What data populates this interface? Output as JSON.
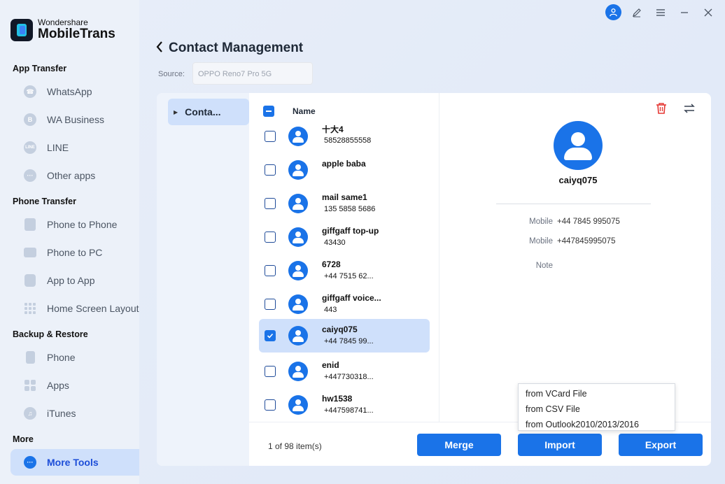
{
  "brand": {
    "line1": "Wondershare",
    "line2": "MobileTrans"
  },
  "sidebar": {
    "sections": [
      {
        "title": "App Transfer",
        "items": [
          {
            "label": "WhatsApp",
            "icon": "whatsapp-icon"
          },
          {
            "label": "WA Business",
            "icon": "wa-business-icon"
          },
          {
            "label": "LINE",
            "icon": "line-icon"
          },
          {
            "label": "Other apps",
            "icon": "other-apps-icon"
          }
        ]
      },
      {
        "title": "Phone Transfer",
        "items": [
          {
            "label": "Phone to Phone",
            "icon": "phone-to-phone-icon"
          },
          {
            "label": "Phone to PC",
            "icon": "phone-to-pc-icon"
          },
          {
            "label": "App to App",
            "icon": "app-to-app-icon"
          },
          {
            "label": "Home Screen Layout",
            "icon": "home-screen-layout-icon"
          }
        ]
      },
      {
        "title": "Backup & Restore",
        "items": [
          {
            "label": "Phone",
            "icon": "phone-backup-icon"
          },
          {
            "label": "Apps",
            "icon": "apps-backup-icon"
          },
          {
            "label": "iTunes",
            "icon": "itunes-icon"
          }
        ]
      },
      {
        "title": "More",
        "items": [
          {
            "label": "More Tools",
            "icon": "more-tools-icon",
            "active": true
          }
        ]
      }
    ]
  },
  "header": {
    "title": "Contact Management",
    "source_label": "Source:",
    "source_value": "OPPO Reno7 Pro 5G"
  },
  "folders": [
    {
      "label": "Conta..."
    }
  ],
  "list": {
    "header_name": "Name",
    "rows": [
      {
        "name": "十大4",
        "phone": "58528855558",
        "checked": false
      },
      {
        "name": "apple  baba",
        "phone": "",
        "checked": false
      },
      {
        "name": "mail same1",
        "phone": "135 5858 5686",
        "checked": false
      },
      {
        "name": "giffgaff  top-up",
        "phone": "43430",
        "checked": false
      },
      {
        "name": "6728",
        "phone": "+44 7515 62...",
        "checked": false
      },
      {
        "name": "giffgaff  voice...",
        "phone": "443",
        "checked": false
      },
      {
        "name": "caiyq075",
        "phone": "+44 7845 99...",
        "checked": true
      },
      {
        "name": "enid",
        "phone": "+447730318...",
        "checked": false
      },
      {
        "name": "hw1538",
        "phone": "+447598741...",
        "checked": false
      }
    ]
  },
  "detail": {
    "name": "caiyq075",
    "fields": [
      {
        "label": "Mobile",
        "value": "+44 7845 995075"
      },
      {
        "label": "Mobile",
        "value": "+447845995075"
      },
      {
        "label": "Note",
        "value": ""
      }
    ]
  },
  "footer": {
    "count_text": "1  of  98  item(s)",
    "merge_label": "Merge",
    "import_label": "Import",
    "export_label": "Export"
  },
  "import_menu": {
    "options": [
      "from VCard File",
      "from CSV File",
      "from Outlook2010/2013/2016"
    ]
  },
  "colors": {
    "accent": "#1a73e8",
    "selected_bg": "#cfe0fb",
    "danger": "#e53935"
  }
}
